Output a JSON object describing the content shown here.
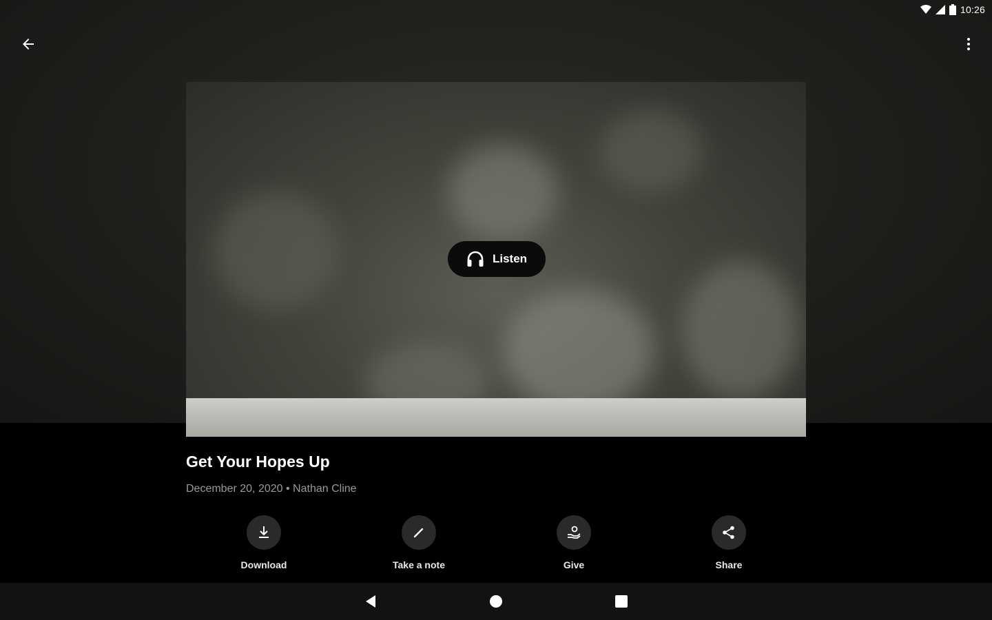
{
  "status_bar": {
    "time": "10:26"
  },
  "episode": {
    "title": "Get Your Hopes Up",
    "date": "December 20, 2020",
    "separator": "•",
    "speaker": "Nathan Cline"
  },
  "hero": {
    "listen_label": "Listen"
  },
  "actions": [
    {
      "label": "Download",
      "icon": "download-icon"
    },
    {
      "label": "Take a note",
      "icon": "pencil-icon"
    },
    {
      "label": "Give",
      "icon": "give-hand-icon"
    },
    {
      "label": "Share",
      "icon": "share-icon"
    }
  ],
  "colors": {
    "background": "#000000",
    "top_background": "#1e1e1b",
    "action_circle": "#2a2a2a",
    "meta_text": "#9a9a9a",
    "nav_bar": "#121212"
  }
}
